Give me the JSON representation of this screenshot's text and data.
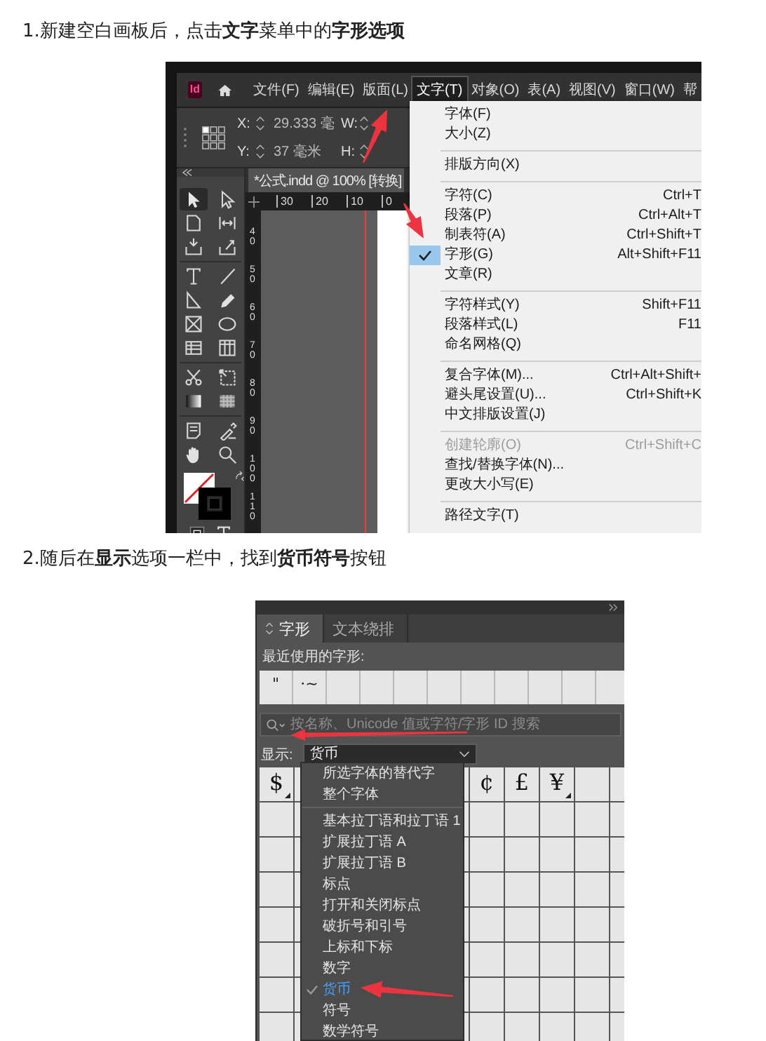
{
  "sections": [
    {
      "kind": "text",
      "text": "1.新建空白画板后，点击**文字**菜单中的**字形选项**"
    },
    {
      "kind": "indesign_window",
      "app_logo": "Id",
      "menu_bar": [
        {
          "label": "文件(F)",
          "selected": false
        },
        {
          "label": "编辑(E)",
          "selected": false
        },
        {
          "label": "版面(L)",
          "selected": false
        },
        {
          "label": "文字(T)",
          "selected": true
        },
        {
          "label": "对象(O)",
          "selected": false
        },
        {
          "label": "表(A)",
          "selected": false
        },
        {
          "label": "视图(V)",
          "selected": false
        },
        {
          "label": "窗口(W)",
          "selected": false
        },
        {
          "label": "帮",
          "selected": false
        }
      ],
      "control_bar": {
        "x_label": "X:",
        "x_value": "29.333 毫",
        "y_label": "Y:",
        "y_value": "37 毫米",
        "w_label": "W:",
        "h_label": "H:"
      },
      "document_tab": "*公式.indd @ 100% [转换]",
      "ruler_marks": [
        "30",
        "20",
        "10",
        "0"
      ],
      "vertical_ruler_marks": [
        "40",
        "50",
        "60",
        "70",
        "80",
        "90",
        "100",
        "110"
      ],
      "menu": [
        {
          "kind": "item",
          "label": "字体(F)",
          "checked": false,
          "disabled": false
        },
        {
          "kind": "item",
          "label": "大小(Z)",
          "checked": false,
          "disabled": false
        },
        {
          "kind": "separator"
        },
        {
          "kind": "item",
          "label": "排版方向(X)",
          "checked": false,
          "disabled": false
        },
        {
          "kind": "separator"
        },
        {
          "kind": "item",
          "label": "字符(C)",
          "shortcut": "Ctrl+T",
          "checked": false,
          "disabled": false
        },
        {
          "kind": "item",
          "label": "段落(P)",
          "shortcut": "Ctrl+Alt+T",
          "checked": false,
          "disabled": false
        },
        {
          "kind": "item",
          "label": "制表符(A)",
          "shortcut": "Ctrl+Shift+T",
          "checked": false,
          "disabled": false
        },
        {
          "kind": "item",
          "label": "字形(G)",
          "shortcut": "Alt+Shift+F11",
          "checked": true,
          "disabled": false
        },
        {
          "kind": "item",
          "label": "文章(R)",
          "checked": false,
          "disabled": false
        },
        {
          "kind": "separator"
        },
        {
          "kind": "item",
          "label": "字符样式(Y)",
          "shortcut": "Shift+F11",
          "checked": false,
          "disabled": false
        },
        {
          "kind": "item",
          "label": "段落样式(L)",
          "shortcut": "F11",
          "checked": false,
          "disabled": false
        },
        {
          "kind": "item",
          "label": "命名网格(Q)",
          "checked": false,
          "disabled": false
        },
        {
          "kind": "separator"
        },
        {
          "kind": "item",
          "label": "复合字体(M)...",
          "shortcut": "Ctrl+Alt+Shift+",
          "checked": false,
          "disabled": false
        },
        {
          "kind": "item",
          "label": "避头尾设置(U)...",
          "shortcut": "Ctrl+Shift+K",
          "checked": false,
          "disabled": false
        },
        {
          "kind": "item",
          "label": "中文排版设置(J)",
          "checked": false,
          "disabled": false
        },
        {
          "kind": "separator"
        },
        {
          "kind": "item",
          "label": "创建轮廓(O)",
          "shortcut": "Ctrl+Shift+C",
          "checked": false,
          "disabled": true
        },
        {
          "kind": "item",
          "label": "查找/替换字体(N)...",
          "checked": false,
          "disabled": false
        },
        {
          "kind": "item",
          "label": "更改大小写(E)",
          "checked": false,
          "disabled": false
        },
        {
          "kind": "separator"
        },
        {
          "kind": "item",
          "label": "路径文字(T)",
          "checked": false,
          "disabled": false
        }
      ]
    },
    {
      "kind": "text",
      "text": "2.随后在**显示**选项一栏中，找到**货币符号**按钮"
    },
    {
      "kind": "glyphs_panel",
      "tabs": [
        {
          "label": "字形",
          "selected": true
        },
        {
          "label": "文本绕排",
          "selected": false
        }
      ],
      "recent_label": "最近使用的字形:",
      "recent_glyphs": [
        "\"",
        "·~"
      ],
      "search": {
        "placeholder": "按名称、Unicode 值或字符/字形 ID 搜索"
      },
      "show_label": "显示:",
      "show_value": "货币",
      "glyph_cells_left": [
        {
          "glyph": "$",
          "alternates": true
        }
      ],
      "glyph_cells_right": [
        {
          "glyph": "¢",
          "alternates": false
        },
        {
          "glyph": "£",
          "alternates": false
        },
        {
          "glyph": "¥",
          "alternates": true
        }
      ],
      "show_options": [
        {
          "kind": "item",
          "label": "所选字体的替代字",
          "checked": false
        },
        {
          "kind": "item",
          "label": "整个字体",
          "checked": false
        },
        {
          "kind": "separator"
        },
        {
          "kind": "item",
          "label": "基本拉丁语和拉丁语 1",
          "checked": false
        },
        {
          "kind": "item",
          "label": "扩展拉丁语 A",
          "checked": false
        },
        {
          "kind": "item",
          "label": "扩展拉丁语 B",
          "checked": false
        },
        {
          "kind": "item",
          "label": "标点",
          "checked": false
        },
        {
          "kind": "item",
          "label": "打开和关闭标点",
          "checked": false
        },
        {
          "kind": "item",
          "label": "破折号和引号",
          "checked": false
        },
        {
          "kind": "item",
          "label": "上标和下标",
          "checked": false
        },
        {
          "kind": "item",
          "label": "数字",
          "checked": false
        },
        {
          "kind": "item",
          "label": "货币",
          "checked": true
        },
        {
          "kind": "item",
          "label": "符号",
          "checked": false
        },
        {
          "kind": "item",
          "label": "数学符号",
          "checked": false
        }
      ]
    }
  ]
}
